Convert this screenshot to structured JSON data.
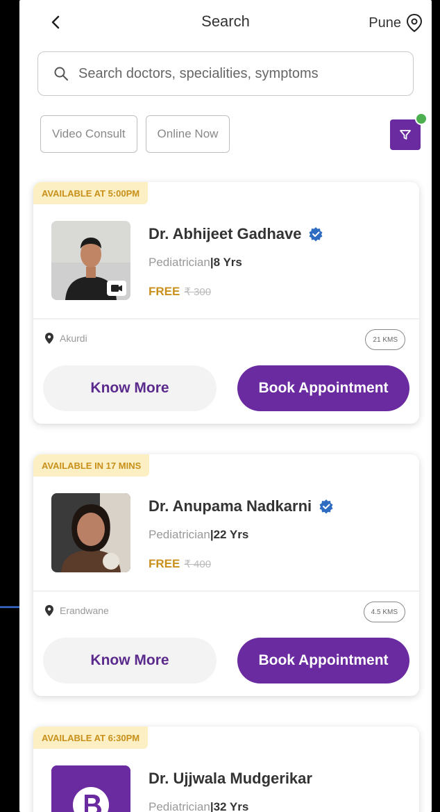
{
  "header": {
    "title": "Search",
    "city": "Pune"
  },
  "search": {
    "placeholder": "Search doctors, specialities, symptoms"
  },
  "chips": [
    "Video Consult",
    "Online Now"
  ],
  "colors": {
    "brand": "#6a2ba0",
    "available": "#c8901a",
    "badge_bg": "#fcefc4",
    "filter_dot": "#4caf50"
  },
  "doctors": [
    {
      "availability": "AVAILABLE AT 5:00PM",
      "name": "Dr. Abhijeet Gadhave",
      "speciality": "Pediatrician",
      "experience": "8 Yrs",
      "fee_label": "FREE",
      "old_fee": "₹ 300",
      "location": "Akurdi",
      "distance": "21 KMS",
      "know_more": "Know More",
      "book": "Book Appointment"
    },
    {
      "availability": "AVAILABLE IN 17 MINS",
      "name": "Dr. Anupama Nadkarni",
      "speciality": "Pediatrician",
      "experience": "22 Yrs",
      "fee_label": "FREE",
      "old_fee": "₹ 400",
      "location": "Erandwane",
      "distance": "4.5 KMS",
      "know_more": "Know More",
      "book": "Book Appointment"
    },
    {
      "availability": "AVAILABLE AT 6:30PM",
      "name": "Dr. Ujjwala Mudgerikar",
      "speciality": "Pediatrician",
      "experience": "32 Yrs"
    }
  ]
}
